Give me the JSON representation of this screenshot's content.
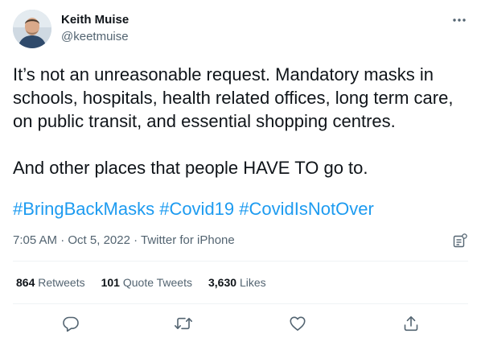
{
  "author": {
    "name": "Keith Muise",
    "handle": "@keetmuise"
  },
  "tweet": {
    "text_paragraph_1": "It’s not an unreasonable request. Mandatory masks in schools, hospitals, health related offices, long term care, on public transit, and essential shopping centres.",
    "text_paragraph_2": "And other places that people HAVE TO go to.",
    "hashtags": [
      "#BringBackMasks",
      "#Covid19",
      "#CovidIsNotOver"
    ]
  },
  "meta": {
    "time": "7:05 AM",
    "separator_1": " · ",
    "date": "Oct 5, 2022",
    "separator_2": " · ",
    "source": "Twitter for iPhone"
  },
  "stats": {
    "retweets_count": "864",
    "retweets_label": "Retweets",
    "quote_tweets_count": "101",
    "quote_tweets_label": "Quote Tweets",
    "likes_count": "3,630",
    "likes_label": "Likes"
  },
  "icons": {
    "more": "more-horizontal-icon",
    "analytics": "analytics-icon",
    "reply": "reply-icon",
    "retweet": "retweet-icon",
    "like": "heart-icon",
    "share": "share-icon"
  },
  "colors": {
    "link": "#1d9bf0",
    "secondary_text": "#536471",
    "primary_text": "#0f1419",
    "divider": "#eff3f4"
  }
}
